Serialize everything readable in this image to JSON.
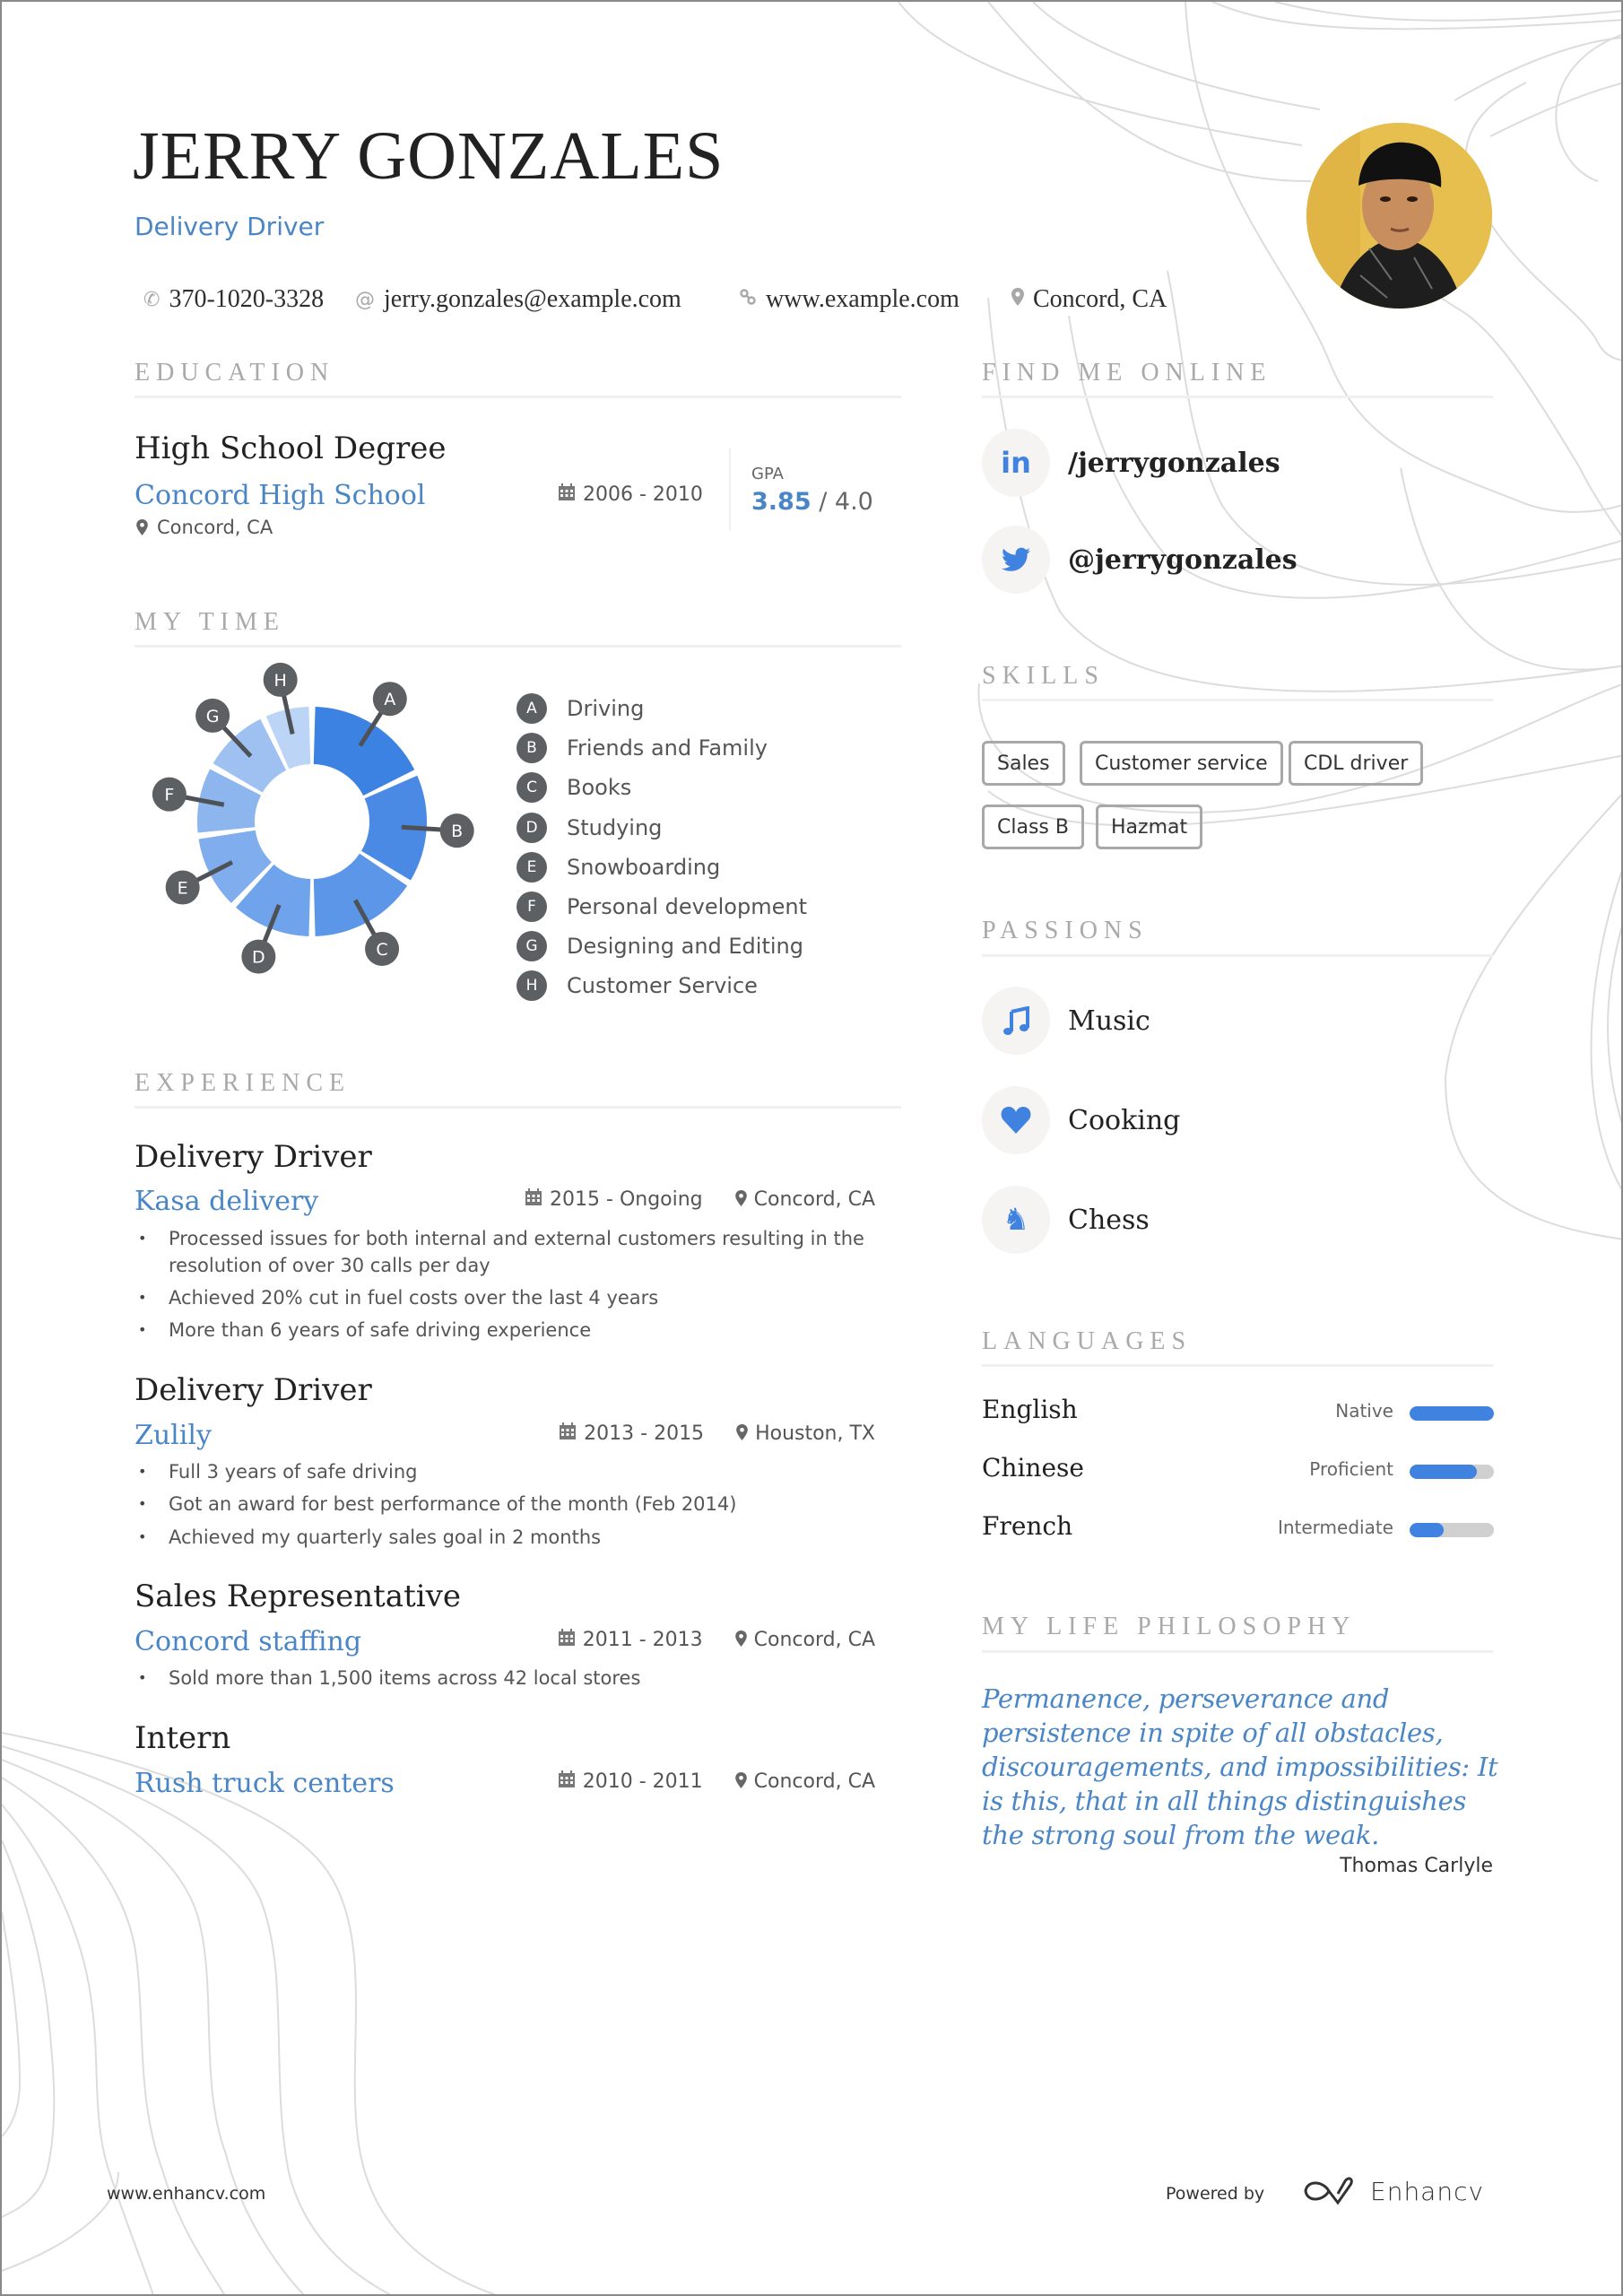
{
  "header": {
    "name": "JERRY GONZALES",
    "title": "Delivery Driver",
    "contact": {
      "phone": "370-1020-3328",
      "email": "jerry.gonzales@example.com",
      "website": "www.example.com",
      "location": "Concord, CA"
    },
    "photo_alt": "Profile photo"
  },
  "sections": {
    "education": "EDUCATION",
    "my_time": "MY TIME",
    "experience": "EXPERIENCE",
    "find_me_online": "FIND ME ONLINE",
    "skills": "SKILLS",
    "passions": "PASSIONS",
    "languages": "LANGUAGES",
    "philosophy": "MY LIFE PHILOSOPHY"
  },
  "education": {
    "degree": "High School Degree",
    "school": "Concord High School",
    "location": "Concord, CA",
    "dates": "2006 - 2010",
    "gpa_label": "GPA",
    "gpa_value": "3.85",
    "gpa_max": "/ 4.0"
  },
  "chart_data": {
    "type": "pie",
    "title": "MY TIME",
    "donut": true,
    "categories": [
      "Driving",
      "Friends and Family",
      "Books",
      "Studying",
      "Snowboarding",
      "Personal development",
      "Designing and Editing",
      "Customer Service"
    ],
    "labels": [
      "A",
      "B",
      "C",
      "D",
      "E",
      "F",
      "G",
      "H"
    ],
    "values": [
      18,
      16,
      16,
      12,
      11,
      10,
      10,
      7
    ],
    "colors": [
      "#3c82e3",
      "#4a8ae5",
      "#5b96e8",
      "#6fa3eb",
      "#7fadee",
      "#8db6ef",
      "#9fc1f2",
      "#bcd5f6"
    ],
    "legend_position": "right"
  },
  "experience": [
    {
      "title": "Delivery Driver",
      "company": "Kasa delivery",
      "dates": "2015 - Ongoing",
      "location": "Concord, CA",
      "bullets": [
        "Processed issues for both internal and external customers resulting in the resolution of over 30 calls per day",
        "Achieved 20% cut in fuel costs over the last 4 years",
        "More than 6 years of safe driving experience"
      ]
    },
    {
      "title": "Delivery Driver",
      "company": "Zulily",
      "dates": "2013 - 2015",
      "location": "Houston, TX",
      "bullets": [
        "Full 3 years of safe driving",
        "Got an award for best performance of the month (Feb 2014)",
        "Achieved my quarterly sales goal in 2 months"
      ]
    },
    {
      "title": "Sales Representative",
      "company": "Concord staffing",
      "dates": "2011 - 2013",
      "location": "Concord, CA",
      "bullets": [
        "Sold more than 1,500 items across 42 local stores"
      ]
    },
    {
      "title": "Intern",
      "company": "Rush truck centers",
      "dates": "2010 - 2011",
      "location": "Concord, CA",
      "bullets": []
    }
  ],
  "online": [
    {
      "icon": "linkedin-icon",
      "text": "/jerrygonzales"
    },
    {
      "icon": "twitter-icon",
      "text": "@jerrygonzales"
    }
  ],
  "skills": [
    "Sales",
    "Customer service",
    "CDL driver",
    "Class B",
    "Hazmat"
  ],
  "passions": [
    {
      "icon": "music-icon",
      "text": "Music"
    },
    {
      "icon": "heart-icon",
      "text": "Cooking"
    },
    {
      "icon": "chess-knight-icon",
      "text": "Chess"
    }
  ],
  "languages": [
    {
      "name": "English",
      "level": "Native",
      "proficiency": 1.0
    },
    {
      "name": "Chinese",
      "level": "Proficient",
      "proficiency": 0.8
    },
    {
      "name": "French",
      "level": "Intermediate",
      "proficiency": 0.4
    }
  ],
  "philosophy": {
    "quote": "Permanence, perseverance and persistence in spite of all obstacles, discouragements, and impossibilities: It is this, that in all things distinguishes the strong soul from the weak.",
    "author": "Thomas Carlyle"
  },
  "footer": {
    "url": "www.enhancv.com",
    "powered_by": "Powered by",
    "brand": "Enhancv"
  },
  "colors": {
    "accent": "#4a86c5",
    "icon_blue": "#3f82e0",
    "heading_gray": "#a9a9a9",
    "badge_gray": "#5d6063"
  }
}
